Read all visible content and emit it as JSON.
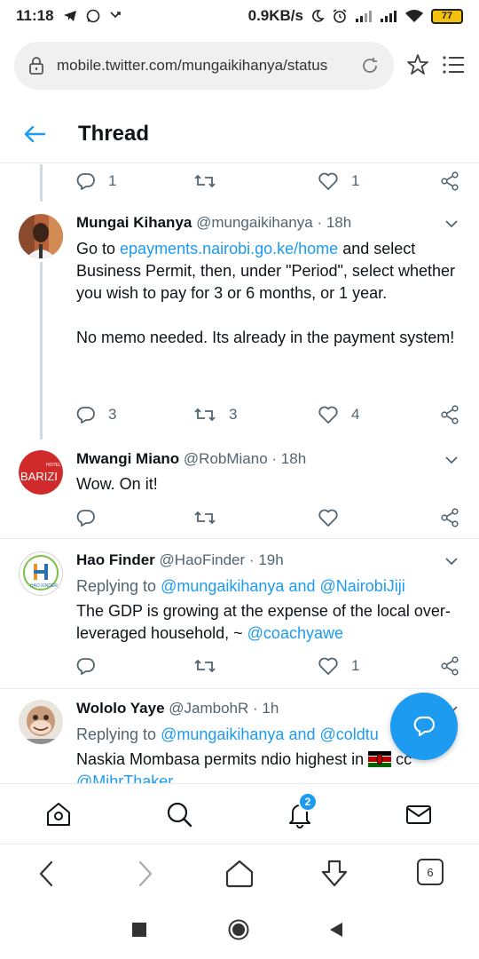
{
  "status_bar": {
    "time": "11:18",
    "network_speed": "0.9KB/s",
    "battery": "77"
  },
  "browser": {
    "url": "mobile.twitter.com/mungaikihanya/status",
    "tab_count": "6"
  },
  "header": {
    "title": "Thread"
  },
  "prev_tweet_actions": {
    "reply_count": "1",
    "retweet_count": "",
    "like_count": "1"
  },
  "tweets": [
    {
      "name": "Mungai Kihanya",
      "handle": "@mungaikihanya",
      "dot": "·",
      "time": "18h",
      "text_pre": "Go to ",
      "link": "epayments.nairobi.go.ke/home",
      "text_post": " and select Business Permit, then, under \"Period\", select whether you wish to pay for 3 or 6 months, or 1 year.",
      "text_p2": "No memo needed. Its already in the payment system!",
      "reply_count": "3",
      "retweet_count": "3",
      "like_count": "4"
    },
    {
      "name": "Mwangi Miano",
      "handle": "@RobMiano",
      "dot": "·",
      "time": "18h",
      "text": "Wow. On it!",
      "reply_count": "",
      "retweet_count": "",
      "like_count": ""
    },
    {
      "name": "Hao Finder",
      "handle": "@HaoFinder",
      "dot": "·",
      "time": "19h",
      "replying_label": "Replying to",
      "replying_to_1": "@mungaikihanya",
      "replying_and": "and",
      "replying_to_2": "@NairobiJiji",
      "text": "The GDP is growing at the expense of the local over-leveraged household, ~ ",
      "mention": "@coachyawe",
      "reply_count": "",
      "retweet_count": "",
      "like_count": "1"
    },
    {
      "name": "Wololo Yaye",
      "handle": "@JambohR",
      "dot": "·",
      "time": "1h",
      "replying_label": "Replying to",
      "replying_to_1": "@mungaikihanya",
      "replying_and": "and",
      "replying_to_2": "@coldtu",
      "text": "Naskia Mombasa permits ndio highest in ",
      "text_after_flag": " cc",
      "mention": "@MihrThaker"
    }
  ],
  "nav": {
    "notifications_badge": "2"
  },
  "avatar_texts": {
    "barizi": "BARIZI",
    "hotel": "HOTEL",
    "hao_finder_logo": "HAO FINDER"
  },
  "colors": {
    "accent": "#1d9bf0",
    "text": "#0f1419",
    "muted": "#536471",
    "divider": "#e6ecf0"
  }
}
